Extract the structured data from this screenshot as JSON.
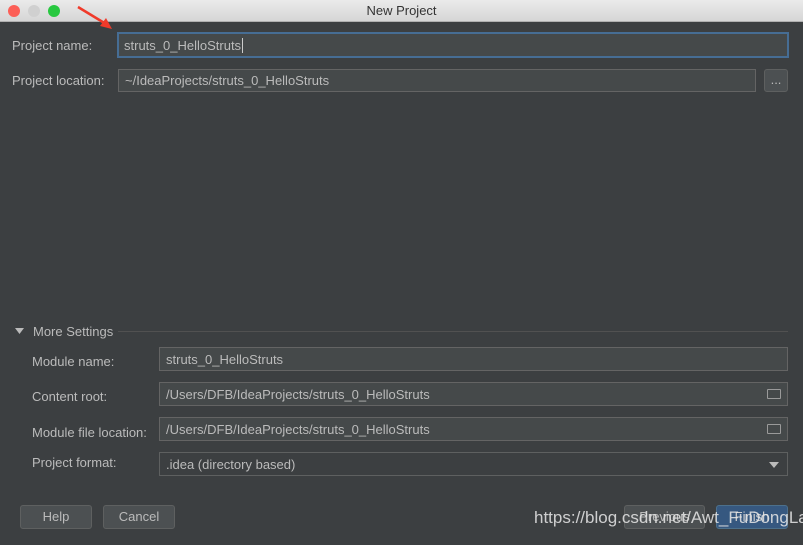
{
  "window": {
    "title": "New Project",
    "colors": {
      "close": "#fc5f57",
      "minimize": "#d0d0d0",
      "zoom": "#28c840",
      "accent": "#466d94"
    }
  },
  "project": {
    "name_label": "Project name:",
    "name_value": "struts_0_HelloStruts",
    "location_label": "Project location:",
    "location_value": "~/IdeaProjects/struts_0_HelloStruts",
    "browse_label": "..."
  },
  "more": {
    "title": "More Settings",
    "module_name_label": "Module name:",
    "module_name_value": "struts_0_HelloStruts",
    "content_root_label": "Content root:",
    "content_root_value": "/Users/DFB/IdeaProjects/struts_0_HelloStruts",
    "module_file_label": "Module file location:",
    "module_file_value": "/Users/DFB/IdeaProjects/struts_0_HelloStruts",
    "format_label": "Project format:",
    "format_value": ".idea (directory based)"
  },
  "buttons": {
    "help": "Help",
    "cancel": "Cancel",
    "previous": "Previous",
    "finish": "Finish"
  },
  "watermark": "https://blog.csdn.net/Awt_FuDongLai"
}
